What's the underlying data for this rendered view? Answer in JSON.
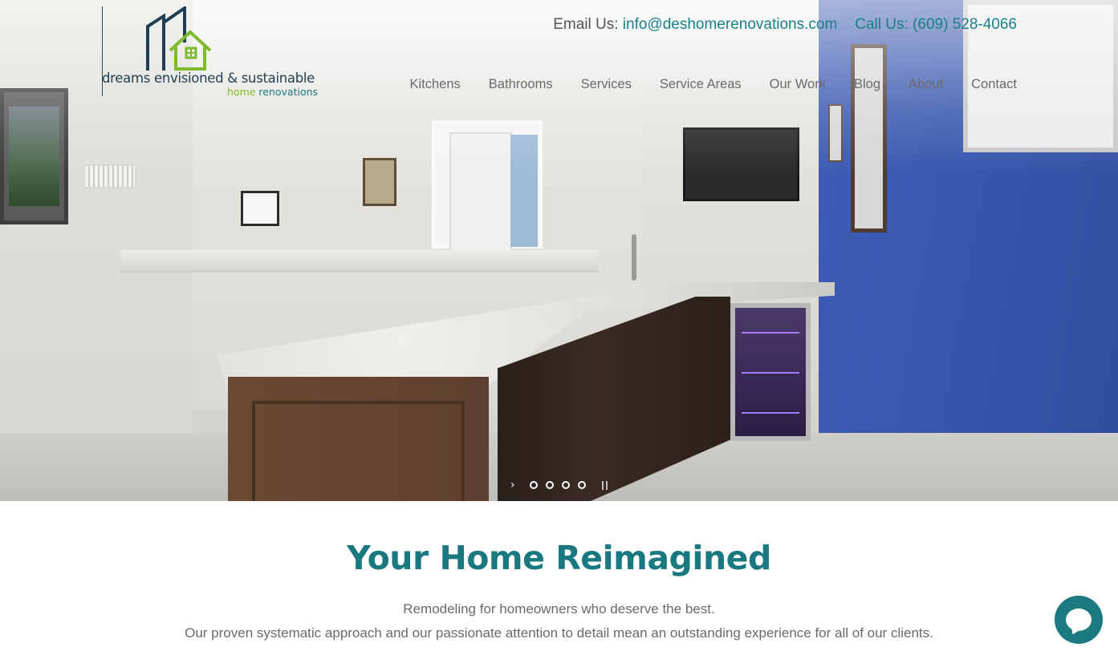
{
  "header": {
    "logo": {
      "line1": "dreams envisioned & sustainable",
      "line2_a": "home",
      "line2_b": " renovations"
    },
    "contact": {
      "email_label": "Email Us: ",
      "email_value": "info@deshomerenovations.com",
      "phone_label": "Call Us: ",
      "phone_value": "(609) 528-4066"
    },
    "nav": [
      {
        "label": "Kitchens"
      },
      {
        "label": "Bathrooms"
      },
      {
        "label": "Services"
      },
      {
        "label": "Service Areas"
      },
      {
        "label": "Our Work"
      },
      {
        "label": "Blog"
      },
      {
        "label": "About"
      },
      {
        "label": "Contact"
      }
    ]
  },
  "slider": {
    "next_glyph": "›",
    "dots": 4
  },
  "main": {
    "headline": "Your Home Reimagined",
    "subtitle1": "Remodeling for homeowners who deserve the best.",
    "subtitle2": "Our proven systematic approach and our passionate attention to detail mean an outstanding experience for all of our clients."
  },
  "colors": {
    "accent": "#1a7880",
    "logo_navy": "#1f3e52",
    "logo_green": "#7dba2e",
    "wall_blue": "#3a58ad"
  },
  "icons": {
    "chat": "chat-bubble-icon",
    "next": "chevron-right-icon",
    "pause": "pause-icon"
  }
}
